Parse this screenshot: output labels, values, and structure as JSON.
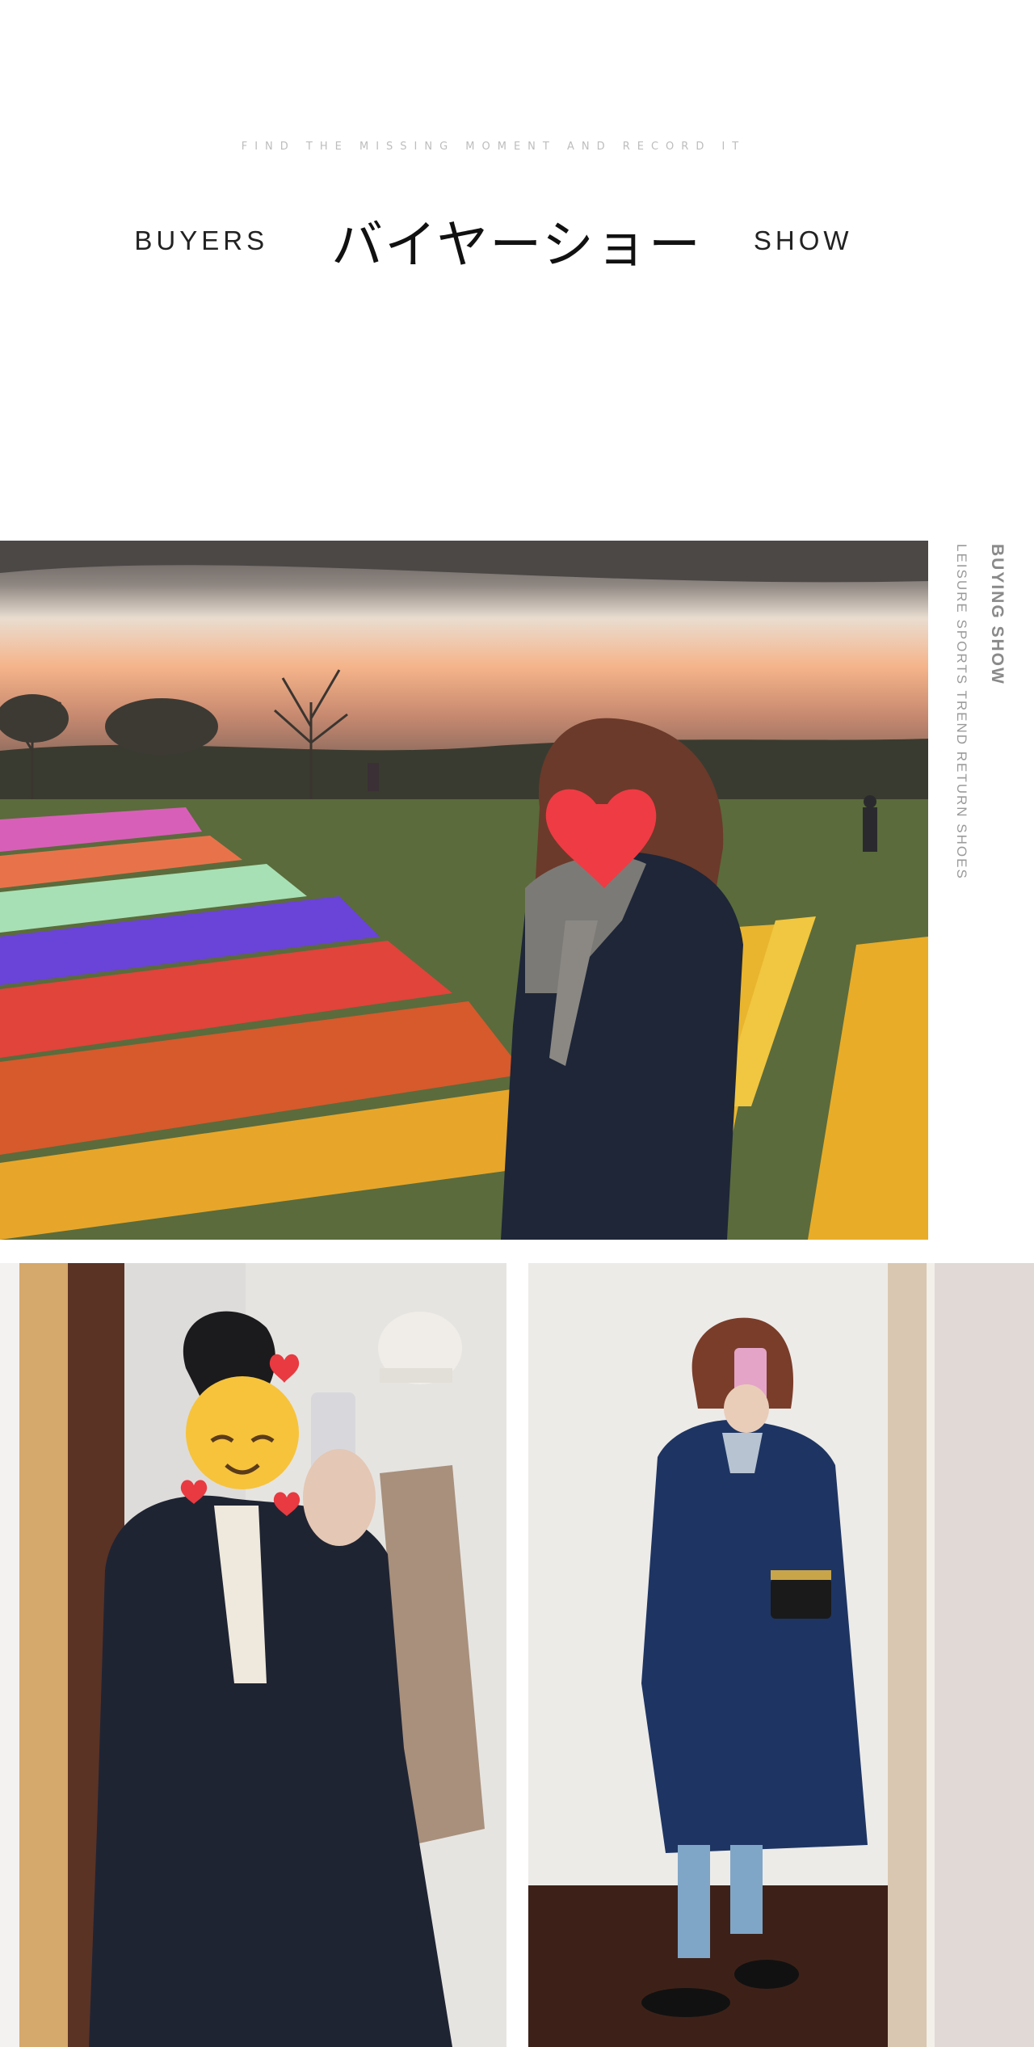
{
  "header": {
    "tagline": "FIND THE MISSING MOMENT AND RECORD IT",
    "title_left": "BUYERS",
    "title_main": "バイヤーショー",
    "title_right": "SHOW"
  },
  "side_label": {
    "main": "BUYING SHOW",
    "sub": "LEISURE SPORTS TREND RETURN SHOES"
  },
  "photos": [
    {
      "id": "flower-field",
      "subject": "woman in navy trench coat and grey scarf at flower field sunset"
    },
    {
      "id": "mirror-left",
      "subject": "mirror selfie in navy trench coat"
    },
    {
      "id": "mirror-right",
      "subject": "full-length mirror selfie in navy belted trench coat"
    }
  ],
  "colors": {
    "coat_navy": "#1c2740",
    "background": "#ffffff",
    "heart_red": "#ef3b44"
  }
}
